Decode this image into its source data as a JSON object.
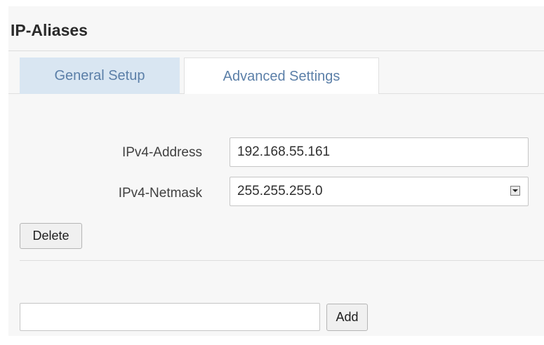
{
  "section": {
    "title": "IP-Aliases"
  },
  "tabs": [
    {
      "label": "General Setup",
      "active": true
    },
    {
      "label": "Advanced Settings",
      "active": false
    }
  ],
  "fields": {
    "ipv4_address": {
      "label": "IPv4-Address",
      "value": "192.168.55.161"
    },
    "ipv4_netmask": {
      "label": "IPv4-Netmask",
      "value": "255.255.255.0"
    }
  },
  "buttons": {
    "delete_label": "Delete",
    "add_label": "Add"
  },
  "new_alias": {
    "value": "",
    "placeholder": ""
  },
  "colors": {
    "tab_active_bg": "#d9e6f2",
    "tab_text": "#5b7fa8",
    "panel_bg": "#f7f7f7"
  }
}
